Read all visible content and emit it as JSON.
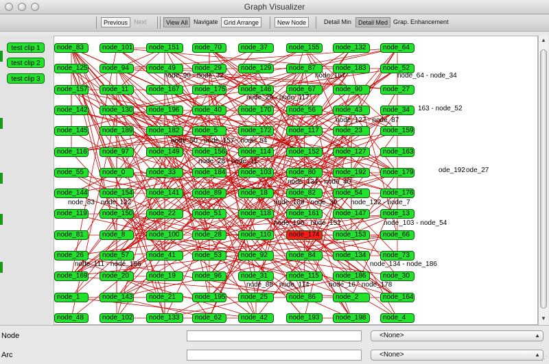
{
  "window": {
    "title": "Graph Visualizer"
  },
  "toolbar": {
    "previous": "Previous",
    "next": "Next",
    "view_all": "View All",
    "navigate": "Navigate",
    "grid_arrange": "Grid Arrange",
    "new_node": "New Node",
    "detail_min": "Detail Min",
    "detail_med": "Detail Med",
    "graph_enhancement": "Grap. Enhancement"
  },
  "clips": [
    "test clip 1",
    "test clip 2",
    "test clip 3"
  ],
  "graph": {
    "edge_color": "#cc0000",
    "node_color": "#22e22e",
    "selected_node_color": "#ff1a1a",
    "rows": [
      [
        "node_83",
        "node_101",
        "node_151",
        "node_70",
        "node_37",
        "node_155",
        "node_132",
        "node_64"
      ],
      [
        "node_125",
        "node_94",
        "node_49",
        "node_29",
        "node_129",
        "node_87",
        "node_183",
        "node_52"
      ],
      [
        "node_157",
        "node_11",
        "node_167",
        "node_175",
        "node_146",
        "node_67",
        "node_90",
        "node_27"
      ],
      [
        "node_142",
        "node_130",
        "node_196",
        "node_40",
        "node_170",
        "node_56",
        "node_43",
        "node_34"
      ],
      [
        "node_145",
        "node_189",
        "node_182",
        "node_5",
        "node_172",
        "node_117",
        "node_23",
        "node_159"
      ],
      [
        "node_116",
        "node_97",
        "node_149",
        "node_156",
        "node_114",
        "node_152",
        "node_127",
        "node_163"
      ],
      [
        "node_55",
        "node_0",
        "node_33",
        "node_184",
        "node_103",
        "node_80",
        "node_192",
        "node_179"
      ],
      [
        "node_144",
        "node_154",
        "node_141",
        "node_89",
        "node_18",
        "node_82",
        "node_54",
        "node_176"
      ],
      [
        "node_119",
        "node_150",
        "node_22",
        "node_51",
        "node_118",
        "node_161",
        "node_147",
        "node_13"
      ],
      [
        "node_81",
        "node_8",
        "node_100",
        "node_28",
        "node_110",
        "node_174",
        "node_153",
        "node_66"
      ],
      [
        "node_26",
        "node_57",
        "node_41",
        "node_53",
        "node_92",
        "node_84",
        "node_134",
        "node_73"
      ],
      [
        "node_169",
        "node_20",
        "node_19",
        "node_96",
        "node_31",
        "node_115",
        "node_186",
        "node_30"
      ],
      [
        "node_1",
        "node_143",
        "node_21",
        "node_195",
        "node_25",
        "node_86",
        "node_2",
        "node_164"
      ],
      [
        "node_48",
        "node_102",
        "node_133",
        "node_62",
        "node_42",
        "node_193",
        "node_198",
        "node_4"
      ]
    ],
    "selected": "node_174",
    "edge_labels": [
      "node_90 - node_32",
      "node_167",
      "node_64 - node_34",
      "node_29 - node_117",
      "163 - node_52",
      "node_127 - node_87",
      "node_28 - node_11",
      "node_50 - node_157 - node_54",
      "ode_192",
      "ode_27",
      "node_134 - node_40",
      "node_83 - node_122",
      "node_189 - node_30",
      "node_132 - node_7",
      "node_196 - node_152",
      "node_103 - node_54",
      "node_111 - node_186",
      "node_134 - node_186",
      "node_88 - node_114",
      "node_16 - node_178"
    ]
  },
  "form": {
    "node_label": "Node",
    "node_value": "",
    "node_select": "<None>",
    "arc_label": "Arc",
    "arc_value": "",
    "arc_select": "<None>"
  }
}
